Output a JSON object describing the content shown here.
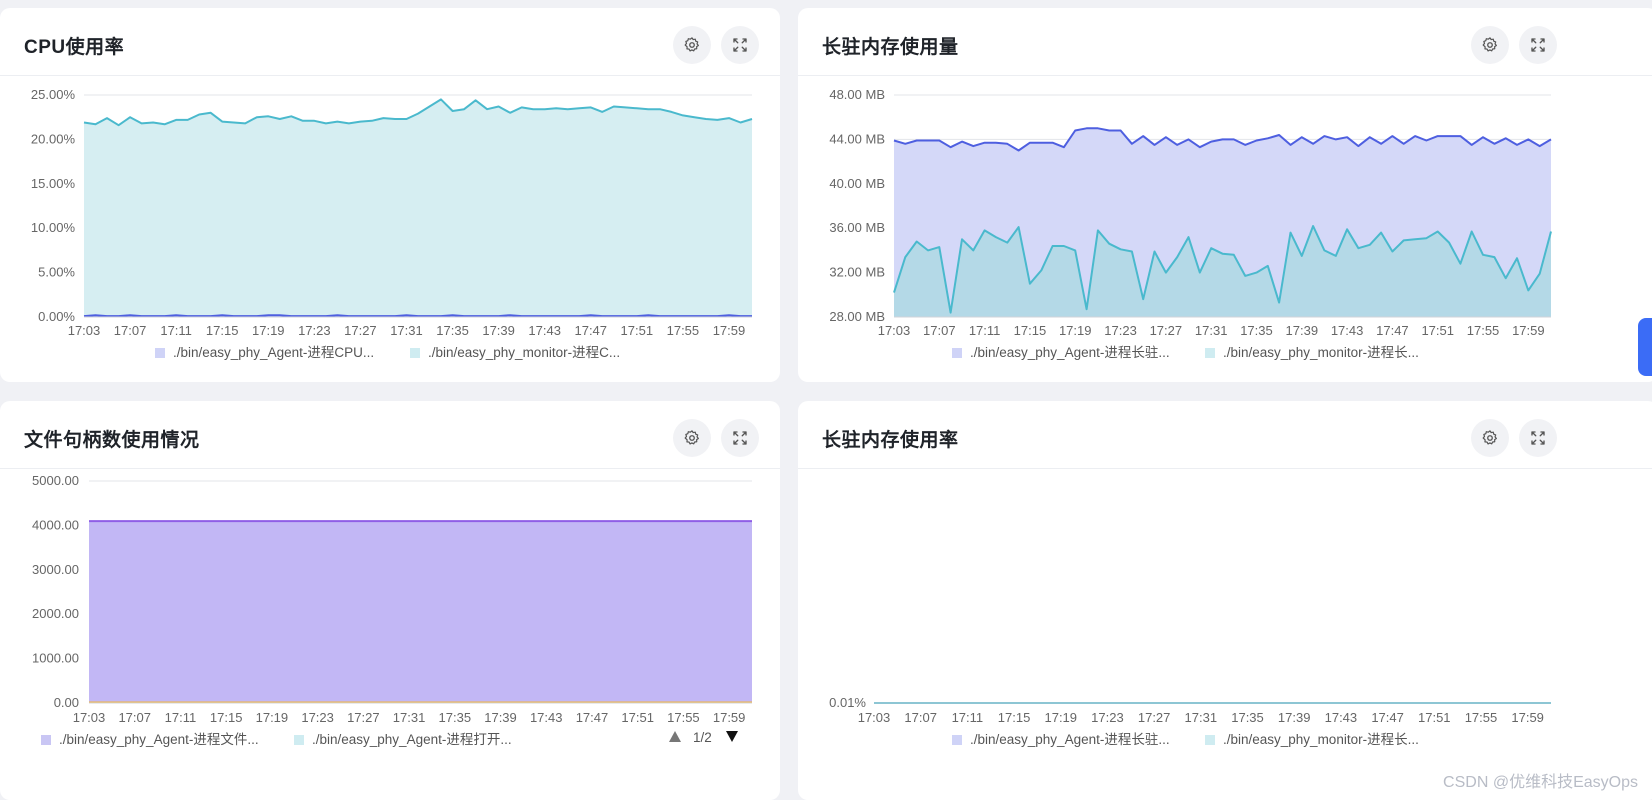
{
  "panels": [
    {
      "title": "CPU使用率",
      "settings_label": "设置",
      "fullscreen_label": "全屏",
      "y_ticks": [
        "25.00%",
        "20.00%",
        "15.00%",
        "10.00%",
        "5.00%",
        "0.00%"
      ],
      "x_ticks": [
        "17:03",
        "17:07",
        "17:11",
        "17:15",
        "17:19",
        "17:23",
        "17:27",
        "17:31",
        "17:35",
        "17:39",
        "17:43",
        "17:47",
        "17:51",
        "17:55",
        "17:59"
      ],
      "legend": [
        "./bin/easy_phy_Agent-进程CPU...",
        "./bin/easy_phy_monitor-进程C..."
      ]
    },
    {
      "title": "长驻内存使用量",
      "settings_label": "设置",
      "fullscreen_label": "全屏",
      "y_ticks": [
        "48.00 MB",
        "44.00 MB",
        "40.00 MB",
        "36.00 MB",
        "32.00 MB",
        "28.00 MB"
      ],
      "x_ticks": [
        "17:03",
        "17:07",
        "17:11",
        "17:15",
        "17:19",
        "17:23",
        "17:27",
        "17:31",
        "17:35",
        "17:39",
        "17:43",
        "17:47",
        "17:51",
        "17:55",
        "17:59"
      ],
      "legend": [
        "./bin/easy_phy_Agent-进程长驻...",
        "./bin/easy_phy_monitor-进程长..."
      ]
    },
    {
      "title": "文件句柄数使用情况",
      "settings_label": "设置",
      "fullscreen_label": "全屏",
      "y_ticks": [
        "5000.00",
        "4000.00",
        "3000.00",
        "2000.00",
        "1000.00",
        "0.00"
      ],
      "x_ticks": [
        "17:03",
        "17:07",
        "17:11",
        "17:15",
        "17:19",
        "17:23",
        "17:27",
        "17:31",
        "17:35",
        "17:39",
        "17:43",
        "17:47",
        "17:51",
        "17:55",
        "17:59"
      ],
      "legend": [
        "./bin/easy_phy_Agent-进程文件...",
        "./bin/easy_phy_Agent-进程打开..."
      ],
      "pager": "1/2"
    },
    {
      "title": "长驻内存使用率",
      "settings_label": "设置",
      "fullscreen_label": "全屏",
      "y_ticks": [
        "0.01%"
      ],
      "x_ticks": [
        "17:03",
        "17:07",
        "17:11",
        "17:15",
        "17:19",
        "17:23",
        "17:27",
        "17:31",
        "17:35",
        "17:39",
        "17:43",
        "17:47",
        "17:51",
        "17:55",
        "17:59"
      ],
      "legend": [
        "./bin/easy_phy_Agent-进程长驻...",
        "./bin/easy_phy_monitor-进程长..."
      ]
    }
  ],
  "watermark": "CSDN @优维科技EasyOps",
  "colors": {
    "cyan_line": "#4ab9cd",
    "cyan_fill": "#d6eef2",
    "blue_line": "#4e5fe0",
    "blue_fill": "#d4d8f8",
    "purple_line": "#8f5ee6",
    "purple_fill": "#c2b7f5",
    "orange_line": "#f2b641"
  },
  "chart_data": [
    {
      "type": "area",
      "title": "CPU使用率",
      "x": [
        "17:03",
        "17:04",
        "17:05",
        "17:06",
        "17:07",
        "17:08",
        "17:09",
        "17:10",
        "17:11",
        "17:12",
        "17:13",
        "17:14",
        "17:15",
        "17:16",
        "17:17",
        "17:18",
        "17:19",
        "17:20",
        "17:21",
        "17:22",
        "17:23",
        "17:24",
        "17:25",
        "17:26",
        "17:27",
        "17:28",
        "17:29",
        "17:30",
        "17:31",
        "17:32",
        "17:33",
        "17:34",
        "17:35",
        "17:36",
        "17:37",
        "17:38",
        "17:39",
        "17:40",
        "17:41",
        "17:42",
        "17:43",
        "17:44",
        "17:45",
        "17:46",
        "17:47",
        "17:48",
        "17:49",
        "17:50",
        "17:51",
        "17:52",
        "17:53",
        "17:54",
        "17:55",
        "17:56",
        "17:57",
        "17:58",
        "17:59",
        "18:00",
        "18:01"
      ],
      "ylim": [
        0,
        25
      ],
      "unit": "%",
      "series": [
        {
          "name": "./bin/easy_phy_Agent-进程CPU...",
          "values": [
            0.1,
            0.2,
            0.1,
            0.1,
            0.2,
            0.1,
            0.1,
            0.1,
            0.2,
            0.1,
            0.1,
            0.1,
            0.2,
            0.1,
            0.1,
            0.1,
            0.2,
            0.2,
            0.1,
            0.1,
            0.1,
            0.1,
            0.2,
            0.1,
            0.1,
            0.1,
            0.1,
            0.1,
            0.2,
            0.1,
            0.1,
            0.1,
            0.2,
            0.1,
            0.1,
            0.1,
            0.1,
            0.2,
            0.1,
            0.1,
            0.1,
            0.1,
            0.1,
            0.1,
            0.2,
            0.1,
            0.1,
            0.1,
            0.1,
            0.2,
            0.1,
            0.1,
            0.1,
            0.1,
            0.1,
            0.1,
            0.2,
            0.1,
            0.1
          ]
        },
        {
          "name": "./bin/easy_phy_monitor-进程C...",
          "values": [
            21.9,
            21.7,
            22.4,
            21.6,
            22.5,
            21.8,
            21.9,
            21.7,
            22.2,
            22.2,
            22.8,
            23.0,
            22.0,
            21.9,
            21.8,
            22.5,
            22.6,
            22.3,
            22.6,
            22.1,
            22.1,
            21.8,
            22.0,
            21.8,
            22.0,
            22.1,
            22.4,
            22.3,
            22.3,
            22.9,
            23.7,
            24.5,
            23.2,
            23.4,
            24.4,
            23.4,
            23.7,
            23.0,
            23.6,
            23.4,
            23.4,
            23.5,
            23.4,
            23.5,
            23.6,
            23.1,
            23.7,
            23.6,
            23.5,
            23.4,
            23.4,
            23.1,
            22.7,
            22.5,
            22.3,
            22.2,
            22.4,
            21.9,
            22.3
          ]
        }
      ]
    },
    {
      "type": "area",
      "title": "长驻内存使用量",
      "x": [
        "17:03",
        "17:04",
        "17:05",
        "17:06",
        "17:07",
        "17:08",
        "17:09",
        "17:10",
        "17:11",
        "17:12",
        "17:13",
        "17:14",
        "17:15",
        "17:16",
        "17:17",
        "17:18",
        "17:19",
        "17:20",
        "17:21",
        "17:22",
        "17:23",
        "17:24",
        "17:25",
        "17:26",
        "17:27",
        "17:28",
        "17:29",
        "17:30",
        "17:31",
        "17:32",
        "17:33",
        "17:34",
        "17:35",
        "17:36",
        "17:37",
        "17:38",
        "17:39",
        "17:40",
        "17:41",
        "17:42",
        "17:43",
        "17:44",
        "17:45",
        "17:46",
        "17:47",
        "17:48",
        "17:49",
        "17:50",
        "17:51",
        "17:52",
        "17:53",
        "17:54",
        "17:55",
        "17:56",
        "17:57",
        "17:58",
        "17:59",
        "18:00",
        "18:01"
      ],
      "ylim": [
        28,
        48
      ],
      "unit": "MB",
      "series": [
        {
          "name": "./bin/easy_phy_Agent-进程长驻...",
          "values": [
            43.9,
            43.6,
            43.9,
            43.9,
            43.9,
            43.3,
            43.8,
            43.4,
            43.7,
            43.7,
            43.6,
            43.0,
            43.7,
            43.7,
            43.7,
            43.3,
            44.8,
            45.0,
            45.0,
            44.8,
            44.8,
            43.6,
            44.3,
            43.5,
            44.2,
            43.5,
            44.0,
            43.3,
            43.8,
            44.0,
            44.0,
            43.5,
            43.9,
            44.1,
            44.4,
            43.5,
            44.2,
            43.6,
            44.3,
            44.0,
            44.2,
            43.4,
            44.2,
            43.6,
            44.3,
            43.6,
            44.3,
            43.9,
            44.3,
            44.3,
            44.3,
            43.5,
            44.2,
            43.6,
            44.1,
            43.5,
            44.0,
            43.4,
            44.0
          ]
        },
        {
          "name": "./bin/easy_phy_monitor-进程长...",
          "values": [
            30.2,
            33.4,
            34.8,
            34.0,
            34.3,
            28.4,
            35.0,
            34.0,
            35.8,
            35.2,
            34.7,
            36.1,
            31.0,
            32.2,
            34.4,
            34.4,
            34.0,
            28.7,
            35.8,
            34.6,
            34.1,
            33.9,
            29.6,
            33.9,
            32.0,
            33.4,
            35.2,
            32.0,
            34.2,
            33.7,
            33.6,
            31.7,
            32.0,
            32.6,
            29.3,
            35.6,
            33.5,
            36.2,
            34.0,
            33.5,
            35.9,
            34.2,
            34.5,
            35.6,
            33.9,
            34.9,
            35.0,
            35.1,
            35.7,
            34.7,
            32.8,
            35.7,
            33.6,
            33.4,
            31.5,
            33.3,
            30.4,
            31.9,
            35.7
          ]
        }
      ]
    },
    {
      "type": "area",
      "title": "文件句柄数使用情况",
      "x": [
        "17:03",
        "17:04",
        "17:05",
        "17:06",
        "17:07",
        "17:08",
        "17:09",
        "17:10",
        "17:11",
        "17:12",
        "17:13",
        "17:14",
        "17:15",
        "17:16",
        "17:17",
        "17:18",
        "17:19",
        "17:20",
        "17:21",
        "17:22",
        "17:23",
        "17:24",
        "17:25",
        "17:26",
        "17:27",
        "17:28",
        "17:29",
        "17:30",
        "17:31",
        "17:32",
        "17:33",
        "17:34",
        "17:35",
        "17:36",
        "17:37",
        "17:38",
        "17:39",
        "17:40",
        "17:41",
        "17:42",
        "17:43",
        "17:44",
        "17:45",
        "17:46",
        "17:47",
        "17:48",
        "17:49",
        "17:50",
        "17:51",
        "17:52",
        "17:53",
        "17:54",
        "17:55",
        "17:56",
        "17:57",
        "17:58",
        "17:59",
        "18:00",
        "18:01"
      ],
      "ylim": [
        0,
        5000
      ],
      "series": [
        {
          "name": "./bin/easy_phy_Agent-进程文件...",
          "values": [
            4096,
            4096,
            4096,
            4096,
            4096,
            4096,
            4096,
            4096,
            4096,
            4096,
            4096,
            4096,
            4096,
            4096,
            4096,
            4096,
            4096,
            4096,
            4096,
            4096,
            4096,
            4096,
            4096,
            4096,
            4096,
            4096,
            4096,
            4096,
            4096,
            4096,
            4096,
            4096,
            4096,
            4096,
            4096,
            4096,
            4096,
            4096,
            4096,
            4096,
            4096,
            4096,
            4096,
            4096,
            4096,
            4096,
            4096,
            4096,
            4096,
            4096,
            4096,
            4096,
            4096,
            4096,
            4096,
            4096,
            4096,
            4096,
            4096
          ]
        },
        {
          "name": "./bin/easy_phy_Agent-进程打开...",
          "values": [
            12,
            12,
            12,
            12,
            12,
            12,
            12,
            12,
            12,
            12,
            12,
            12,
            12,
            12,
            12,
            12,
            12,
            12,
            12,
            12,
            12,
            12,
            12,
            12,
            12,
            12,
            12,
            12,
            12,
            12,
            12,
            12,
            12,
            12,
            12,
            12,
            12,
            12,
            12,
            12,
            12,
            12,
            12,
            12,
            12,
            12,
            12,
            12,
            12,
            12,
            12,
            12,
            12,
            12,
            12,
            12,
            12,
            12,
            12
          ]
        }
      ]
    },
    {
      "type": "area",
      "title": "长驻内存使用率",
      "x": [
        "17:03",
        "17:04",
        "17:05",
        "17:06",
        "17:07",
        "17:08",
        "17:09",
        "17:10",
        "17:11",
        "17:12",
        "17:13",
        "17:14",
        "17:15",
        "17:16",
        "17:17",
        "17:18",
        "17:19",
        "17:20",
        "17:21",
        "17:22",
        "17:23",
        "17:24",
        "17:25",
        "17:26",
        "17:27",
        "17:28",
        "17:29",
        "17:30",
        "17:31",
        "17:32",
        "17:33",
        "17:34",
        "17:35",
        "17:36",
        "17:37",
        "17:38",
        "17:39",
        "17:40",
        "17:41",
        "17:42",
        "17:43",
        "17:44",
        "17:45",
        "17:46",
        "17:47",
        "17:48",
        "17:49",
        "17:50",
        "17:51",
        "17:52",
        "17:53",
        "17:54",
        "17:55",
        "17:56",
        "17:57",
        "17:58",
        "17:59",
        "18:00",
        "18:01"
      ],
      "unit": "%",
      "series": [
        {
          "name": "./bin/easy_phy_Agent-进程长驻...",
          "values": [
            0.01,
            0.01,
            0.01,
            0.01,
            0.01,
            0.01,
            0.01,
            0.01,
            0.01,
            0.01,
            0.01,
            0.01,
            0.01,
            0.01,
            0.01,
            0.01,
            0.01,
            0.01,
            0.01,
            0.01,
            0.01,
            0.01,
            0.01,
            0.01,
            0.01,
            0.01,
            0.01,
            0.01,
            0.01,
            0.01,
            0.01,
            0.01,
            0.01,
            0.01,
            0.01,
            0.01,
            0.01,
            0.01,
            0.01,
            0.01,
            0.01,
            0.01,
            0.01,
            0.01,
            0.01,
            0.01,
            0.01,
            0.01,
            0.01,
            0.01,
            0.01,
            0.01,
            0.01,
            0.01,
            0.01,
            0.01,
            0.01,
            0.01,
            0.01
          ]
        },
        {
          "name": "./bin/easy_phy_monitor-进程长...",
          "values": [
            0.01,
            0.01,
            0.01,
            0.01,
            0.01,
            0.01,
            0.01,
            0.01,
            0.01,
            0.01,
            0.01,
            0.01,
            0.01,
            0.01,
            0.01,
            0.01,
            0.01,
            0.01,
            0.01,
            0.01,
            0.01,
            0.01,
            0.01,
            0.01,
            0.01,
            0.01,
            0.01,
            0.01,
            0.01,
            0.01,
            0.01,
            0.01,
            0.01,
            0.01,
            0.01,
            0.01,
            0.01,
            0.01,
            0.01,
            0.01,
            0.01,
            0.01,
            0.01,
            0.01,
            0.01,
            0.01,
            0.01,
            0.01,
            0.01,
            0.01,
            0.01,
            0.01,
            0.01,
            0.01,
            0.01,
            0.01,
            0.01,
            0.01,
            0.01
          ]
        }
      ]
    }
  ]
}
